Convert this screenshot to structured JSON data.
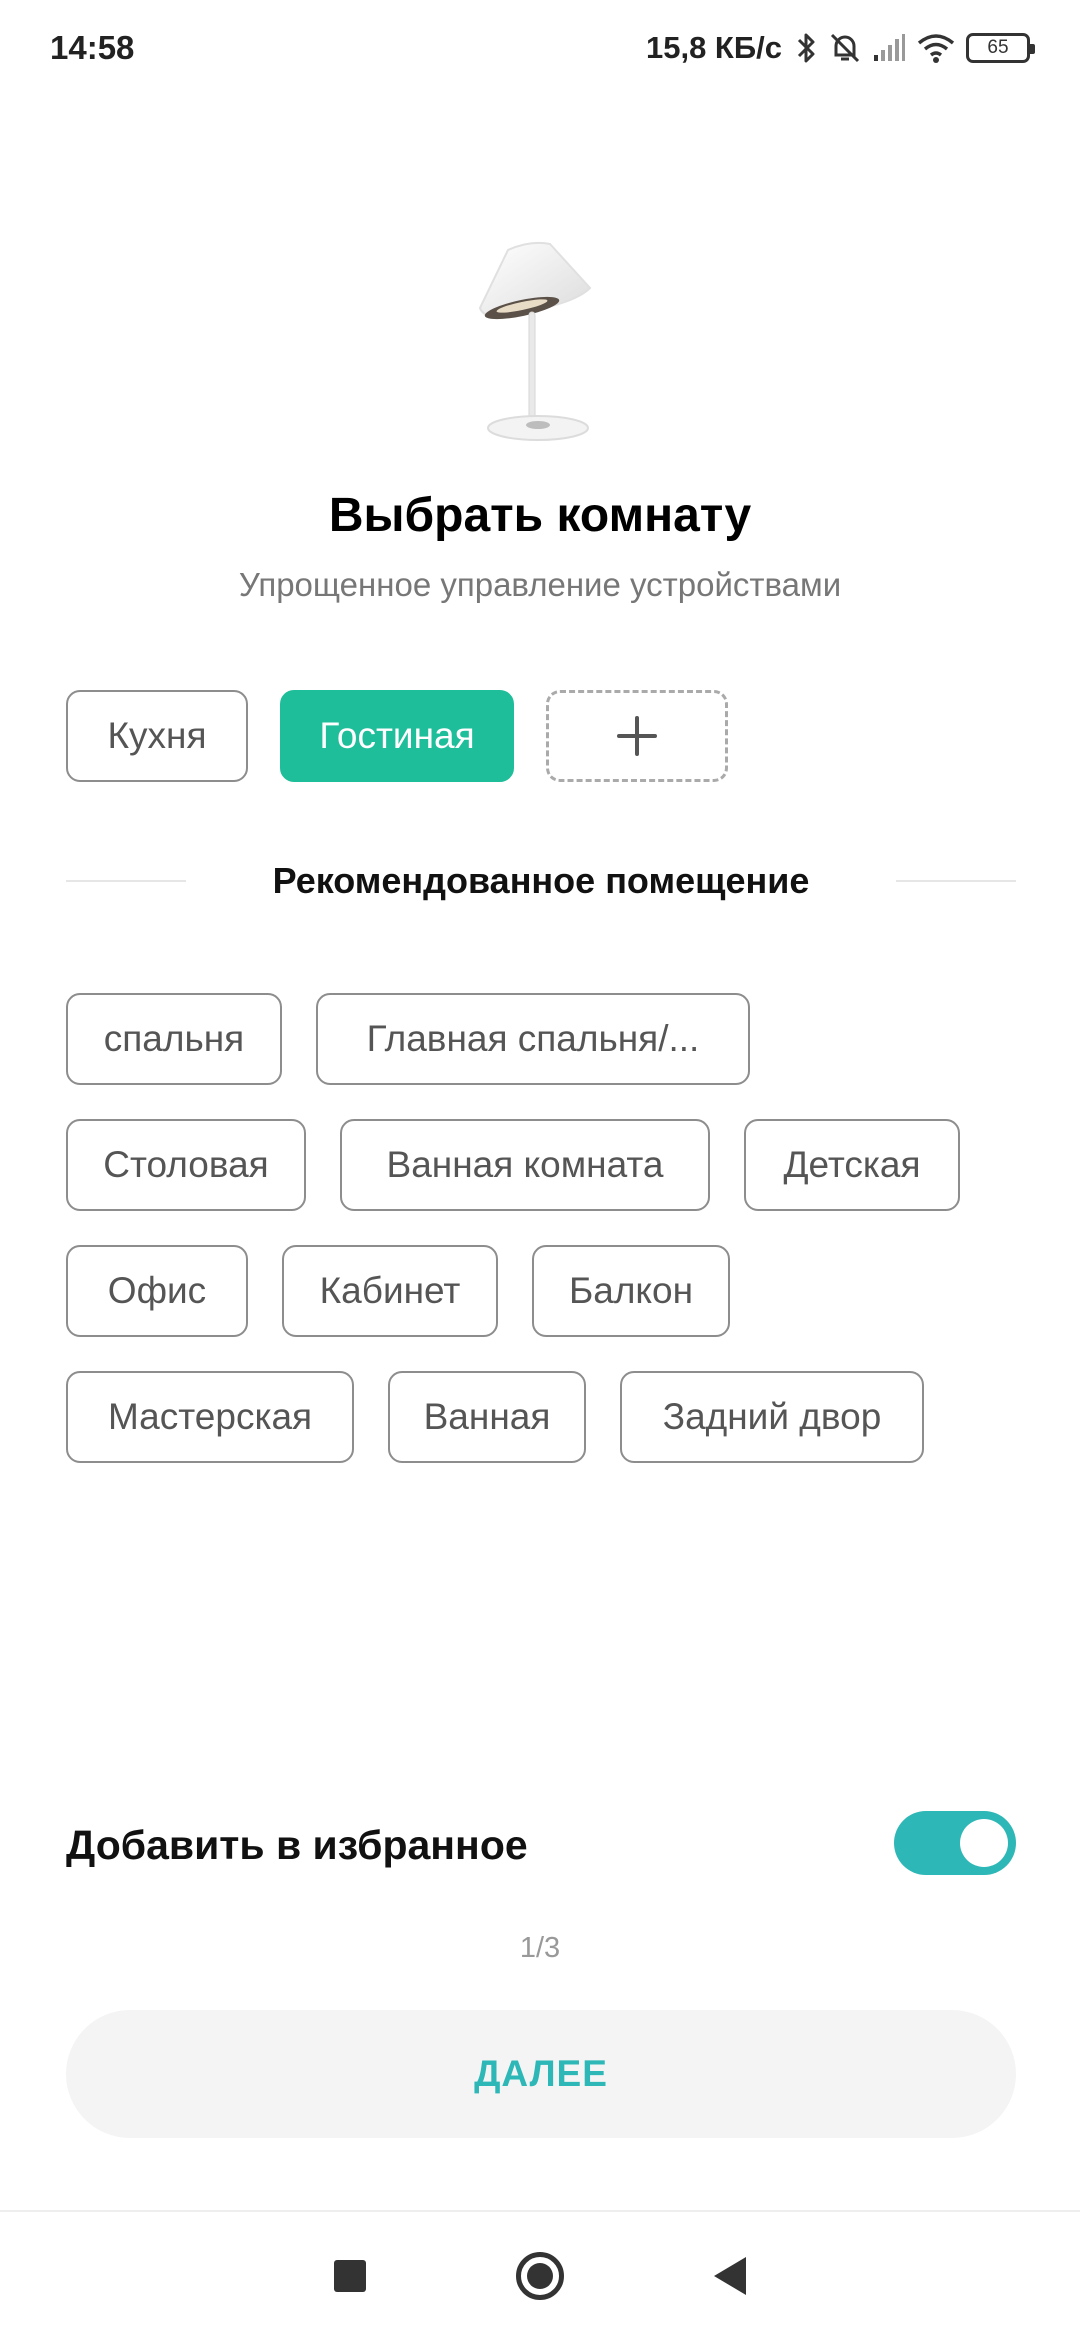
{
  "status_bar": {
    "time": "14:58",
    "net_speed": "15,8 КБ/с",
    "battery": "65",
    "icons": [
      "bluetooth-icon",
      "silent-alarm-icon",
      "signal-icon",
      "wifi-icon",
      "battery-icon"
    ]
  },
  "header": {
    "title": "Выбрать комнату",
    "subtitle": "Упрощенное управление устройствами"
  },
  "rooms": {
    "items": [
      {
        "label": "Кухня",
        "selected": false
      },
      {
        "label": "Гостиная",
        "selected": true
      }
    ],
    "add_icon": "plus-icon",
    "selected_color": "#1fbe9b"
  },
  "recommended": {
    "heading": "Рекомендованное помещение",
    "rows": [
      [
        "спальня",
        "Главная спальня/..."
      ],
      [
        "Столовая",
        "Ванная комната",
        "Детская"
      ],
      [
        "Офис",
        "Кабинет",
        "Балкон"
      ],
      [
        "Мастерская",
        "Ванная",
        "Задний двор"
      ]
    ]
  },
  "favorite": {
    "label": "Добавить в избранное",
    "enabled": true,
    "toggle_color": "#2db7b6"
  },
  "pager": "1/3",
  "next_button": "ДАЛЕЕ",
  "nav": [
    "recents-icon",
    "home-icon",
    "back-icon"
  ]
}
